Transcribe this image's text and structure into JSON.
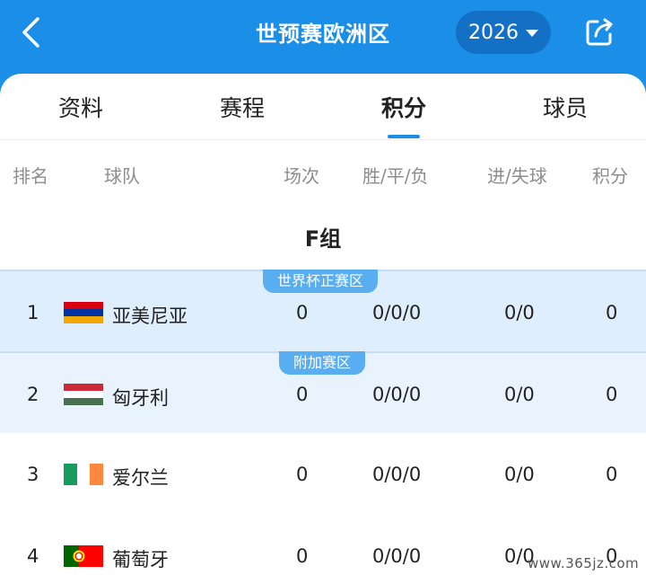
{
  "header": {
    "title": "世预赛欧洲区",
    "year": "2026"
  },
  "tabs": [
    {
      "label": "资料"
    },
    {
      "label": "赛程"
    },
    {
      "label": "积分"
    },
    {
      "label": "球员"
    }
  ],
  "columns": {
    "rank": "排名",
    "team": "球队",
    "played": "场次",
    "wdl": "胜/平/负",
    "goals": "进/失球",
    "points": "积分"
  },
  "group": {
    "title": "F组"
  },
  "zones": {
    "direct": "世界杯正赛区",
    "playoff": "附加赛区"
  },
  "rows": [
    {
      "rank": "1",
      "team": "亚美尼亚",
      "played": "0",
      "wdl": "0/0/0",
      "goals": "0/0",
      "points": "0",
      "flag": {
        "type": "horizontal",
        "colors": [
          "#d90012",
          "#0033a0",
          "#f2a800"
        ]
      }
    },
    {
      "rank": "2",
      "team": "匈牙利",
      "played": "0",
      "wdl": "0/0/0",
      "goals": "0/0",
      "points": "0",
      "flag": {
        "type": "horizontal",
        "colors": [
          "#ce2939",
          "#ffffff",
          "#477050"
        ]
      }
    },
    {
      "rank": "3",
      "team": "爱尔兰",
      "played": "0",
      "wdl": "0/0/0",
      "goals": "0/0",
      "points": "0",
      "flag": {
        "type": "vertical",
        "colors": [
          "#169b62",
          "#ffffff",
          "#ff883e"
        ]
      }
    },
    {
      "rank": "4",
      "team": "葡萄牙",
      "played": "0",
      "wdl": "0/0/0",
      "goals": "0/0",
      "points": "0",
      "flag": {
        "type": "portugal",
        "colors": [
          "#006600",
          "#ff0000"
        ]
      }
    }
  ],
  "watermark": "www.365jz.com",
  "colors": {
    "header_bg": "#1b8fe8",
    "accent": "#1b8fe8",
    "badge": "#58aef0",
    "row_highlight": "#dfeefc"
  }
}
